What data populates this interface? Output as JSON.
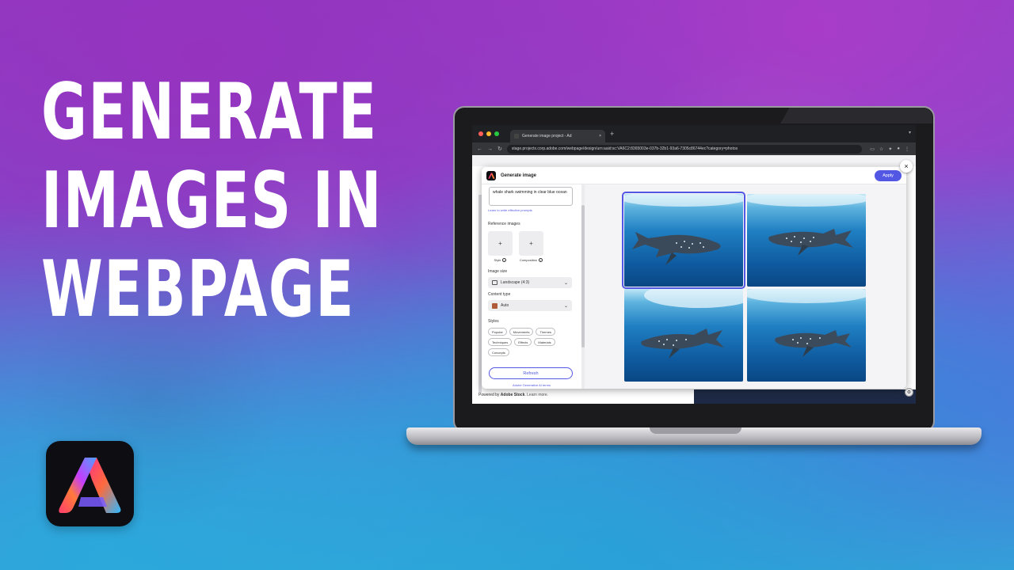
{
  "headline": {
    "line1": "GENERATE",
    "line2": "IMAGES IN",
    "line3": "WEBPAGE"
  },
  "browser": {
    "tab_title": "Generate image project - Ad",
    "new_tab": "+",
    "url": "stage.projectx.corp.adobe.com/webpage/design/urn:aaid:sc:VA6C2:8365003e-037b-32b1-93a6-7305c86744ec?category=photos"
  },
  "modal": {
    "title": "Generate image",
    "apply_label": "Apply",
    "close_label": "×",
    "prompt_value": "whale shark swimming in clear blue ocean",
    "learn_link": "Learn to write effective prompts",
    "reference_label": "Reference images",
    "reference_items": [
      {
        "plus": "+",
        "caption": "Style"
      },
      {
        "plus": "+",
        "caption": "Composition"
      }
    ],
    "image_size_label": "Image size",
    "image_size_value": "Landscape (4:3)",
    "content_type_label": "Content type",
    "content_type_value": "Auto",
    "styles_label": "Styles",
    "style_chips": [
      "Popular",
      "Movements",
      "Themes",
      "Techniques",
      "Effects",
      "Materials",
      "Concepts"
    ],
    "refresh_label": "Refresh",
    "terms_link": "Adobe Generative AI terms"
  },
  "page_behind": {
    "footer_prefix": "Powered by ",
    "footer_brand": "Adobe Stock",
    "footer_link": ". Learn more."
  },
  "gallery": {
    "images": [
      {
        "name": "whale-shark-image-1",
        "selected": true
      },
      {
        "name": "whale-shark-image-2",
        "selected": false
      },
      {
        "name": "whale-shark-image-3",
        "selected": false
      },
      {
        "name": "whale-shark-image-4",
        "selected": false
      }
    ]
  },
  "colors": {
    "accent": "#5258e4",
    "laptop_bezel": "#1b1b1d",
    "ocean_deep": "#0f5ba0"
  }
}
